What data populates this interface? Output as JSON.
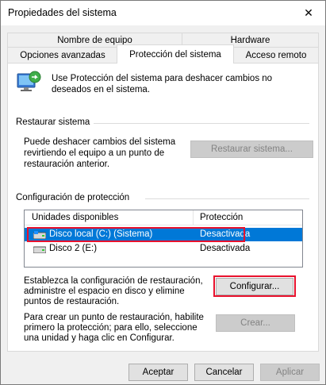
{
  "window": {
    "title": "Propiedades del sistema",
    "close_glyph": "✕"
  },
  "tabs": {
    "row1": [
      "Nombre de equipo",
      "Hardware"
    ],
    "row2": [
      "Opciones avanzadas",
      "Protección del sistema",
      "Acceso remoto"
    ],
    "active": "Protección del sistema"
  },
  "intro": {
    "icon": "system-protection-icon",
    "text": "Use Protección del sistema para deshacer cambios no deseados en el sistema."
  },
  "restore": {
    "heading": "Restaurar sistema",
    "description": "Puede deshacer cambios del sistema revirtiendo el equipo a un punto de restauración anterior.",
    "button": "Restaurar sistema..."
  },
  "protection": {
    "heading": "Configuración de protección",
    "columns": [
      "Unidades disponibles",
      "Protección"
    ],
    "drives": [
      {
        "name": "Disco local (C:) (Sistema)",
        "status": "Desactivada",
        "icon": "system-drive-icon",
        "selected": true
      },
      {
        "name": "Disco 2 (E:)",
        "status": "Desactivada",
        "icon": "drive-icon",
        "selected": false
      }
    ],
    "configure_text": "Establezca la configuración de restauración, administre el espacio en disco y elimine puntos de restauración.",
    "configure_button": "Configurar...",
    "create_text": "Para crear un punto de restauración, habilite primero la protección; para ello, seleccione una unidad y haga clic en Configurar.",
    "create_button": "Crear..."
  },
  "footer": {
    "ok": "Aceptar",
    "cancel": "Cancelar",
    "apply": "Aplicar"
  },
  "colors": {
    "selection": "#0078d7",
    "highlight": "#e8112d"
  }
}
